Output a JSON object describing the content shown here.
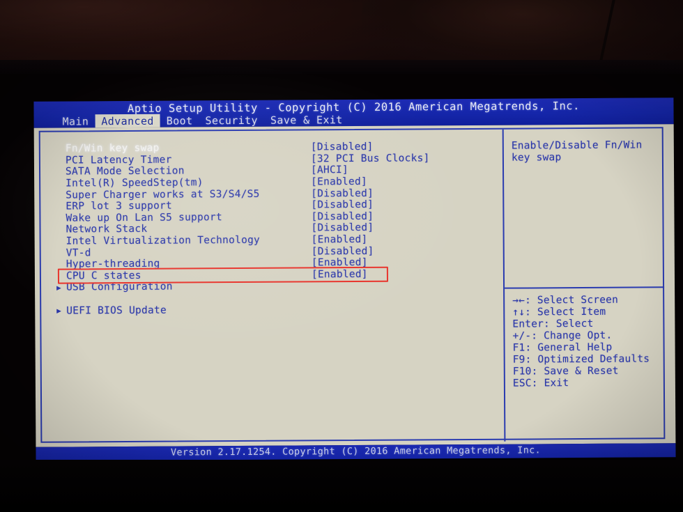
{
  "window": {
    "title": "Aptio Setup Utility - Copyright (C) 2016 American Megatrends, Inc.",
    "footer": "Version 2.17.1254. Copyright (C) 2016 American Megatrends, Inc."
  },
  "tabs": [
    {
      "label": "Main",
      "active": false
    },
    {
      "label": "Advanced",
      "active": true
    },
    {
      "label": "Boot",
      "active": false
    },
    {
      "label": "Security",
      "active": false
    },
    {
      "label": "Save & Exit",
      "active": false
    }
  ],
  "settings": [
    {
      "label": "Fn/Win key swap",
      "value": "[Disabled]",
      "selected": true,
      "submenu": false,
      "highlighted": false
    },
    {
      "label": "PCI Latency Timer",
      "value": "[32 PCI Bus Clocks]",
      "selected": false,
      "submenu": false,
      "highlighted": false
    },
    {
      "label": "SATA Mode Selection",
      "value": "[AHCI]",
      "selected": false,
      "submenu": false,
      "highlighted": false
    },
    {
      "label": "Intel(R) SpeedStep(tm)",
      "value": "[Enabled]",
      "selected": false,
      "submenu": false,
      "highlighted": false
    },
    {
      "label": "Super Charger works at S3/S4/S5",
      "value": "[Disabled]",
      "selected": false,
      "submenu": false,
      "highlighted": false
    },
    {
      "label": "ERP lot 3 support",
      "value": "[Disabled]",
      "selected": false,
      "submenu": false,
      "highlighted": false
    },
    {
      "label": "Wake up On Lan S5 support",
      "value": "[Disabled]",
      "selected": false,
      "submenu": false,
      "highlighted": false
    },
    {
      "label": "Network Stack",
      "value": "[Disabled]",
      "selected": false,
      "submenu": false,
      "highlighted": false
    },
    {
      "label": "Intel Virtualization Technology",
      "value": "[Enabled]",
      "selected": false,
      "submenu": false,
      "highlighted": true
    },
    {
      "label": "VT-d",
      "value": "[Disabled]",
      "selected": false,
      "submenu": false,
      "highlighted": false
    },
    {
      "label": "Hyper-threading",
      "value": "[Enabled]",
      "selected": false,
      "submenu": false,
      "highlighted": false
    },
    {
      "label": "CPU C states",
      "value": "[Enabled]",
      "selected": false,
      "submenu": false,
      "highlighted": false
    },
    {
      "label": "USB Configuration",
      "value": "",
      "selected": false,
      "submenu": true,
      "highlighted": false
    },
    {
      "label": "",
      "value": "",
      "selected": false,
      "submenu": false,
      "highlighted": false
    },
    {
      "label": "UEFI BIOS Update",
      "value": "",
      "selected": false,
      "submenu": true,
      "highlighted": false
    }
  ],
  "help": {
    "text": "Enable/Disable Fn/Win key swap"
  },
  "legend": [
    "→←: Select Screen",
    "↑↓: Select Item",
    "Enter: Select",
    "+/-: Change Opt.",
    "F1: General Help",
    "F9: Optimized Defaults",
    "F10: Save & Reset",
    "ESC: Exit"
  ],
  "icons": {
    "submenu_arrow": "▶"
  },
  "colors": {
    "titlebar_blue": "#1526aa",
    "panel_bg": "#d6d3c3",
    "text_blue": "#2a36a8",
    "highlight_red": "#e8322a",
    "selected_white": "#f4f3ee"
  }
}
